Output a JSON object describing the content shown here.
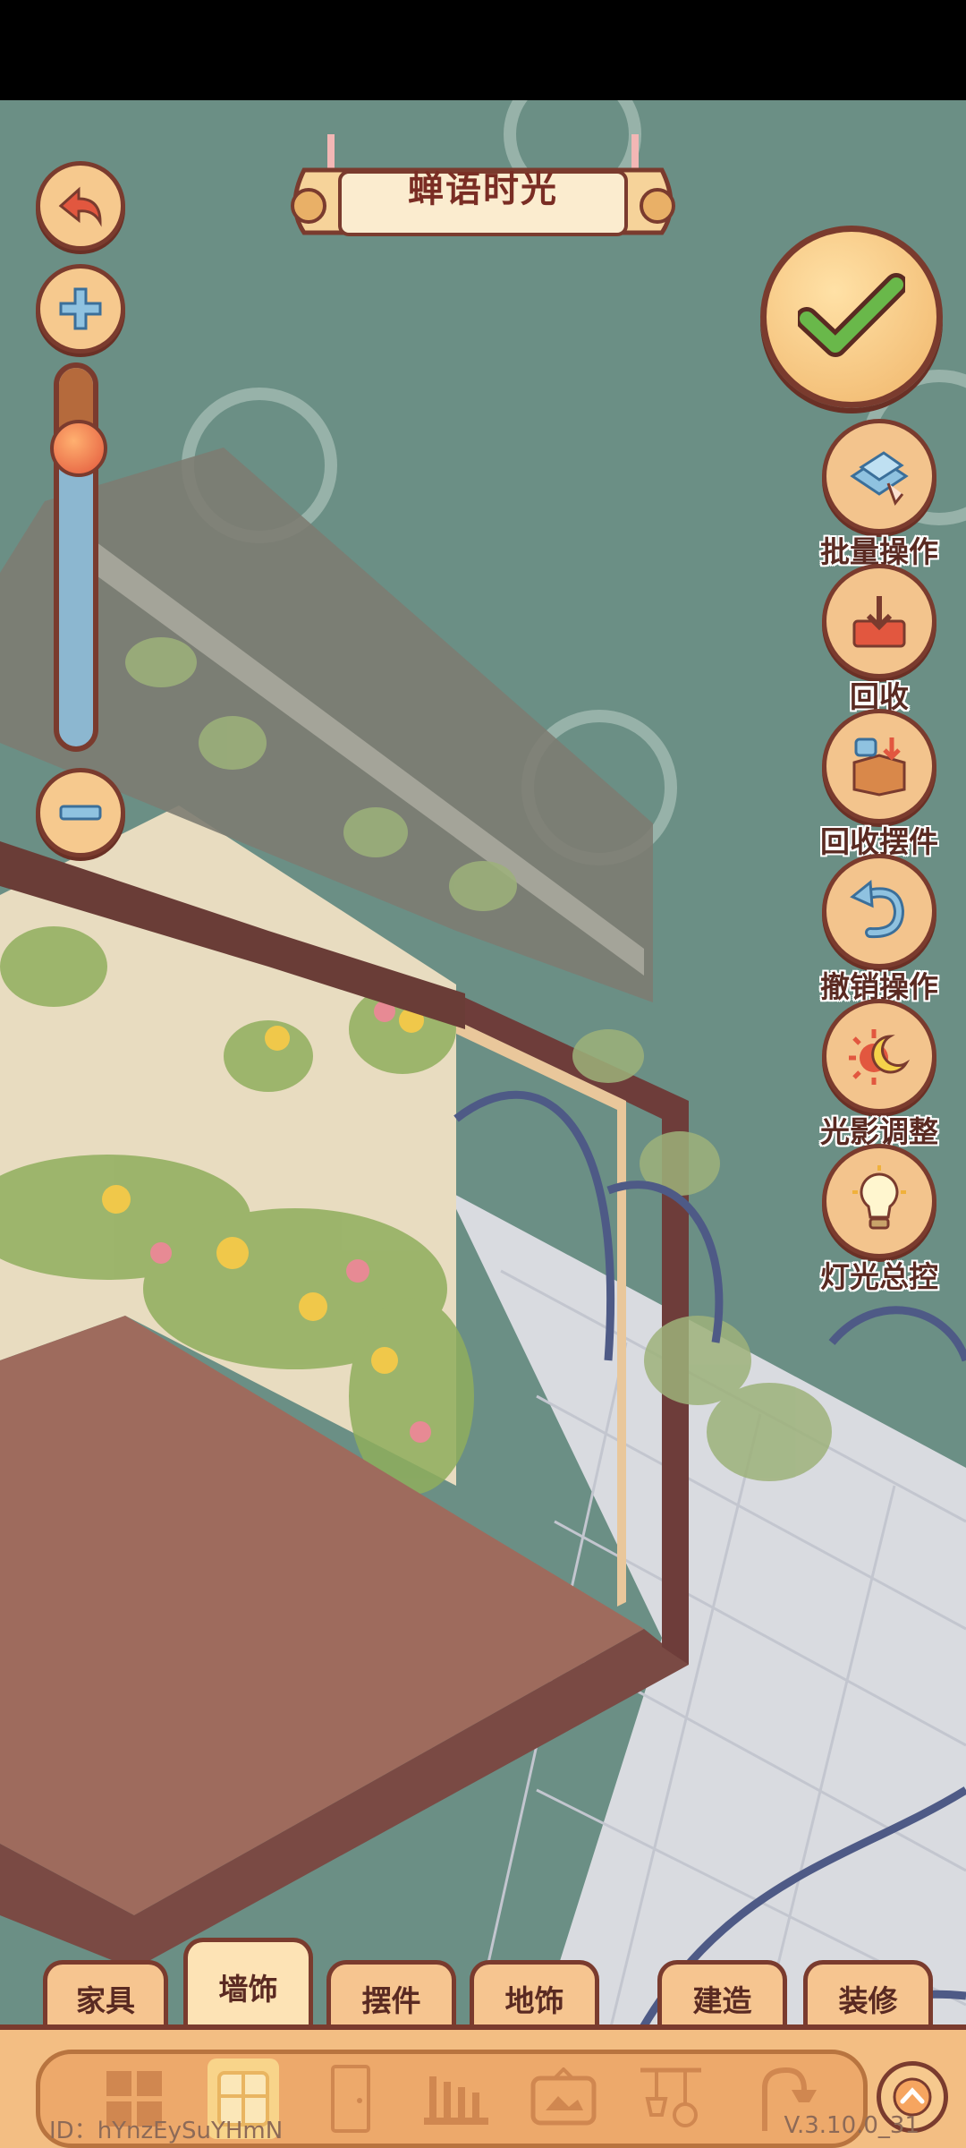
{
  "header": {
    "title": "蝉语时光"
  },
  "zoom": {
    "level": 0.83
  },
  "tools": [
    {
      "label": "批量操作",
      "icon": "batch-select-icon"
    },
    {
      "label": "回收",
      "icon": "recycle-tray-icon"
    },
    {
      "label": "回收摆件",
      "icon": "recycle-box-icon"
    },
    {
      "label": "撤销操作",
      "icon": "undo-arrow-icon"
    },
    {
      "label": "光影调整",
      "icon": "sun-moon-icon"
    },
    {
      "label": "灯光总控",
      "icon": "lightbulb-icon"
    }
  ],
  "tabs": [
    {
      "label": "家具",
      "active": false
    },
    {
      "label": "墙饰",
      "active": true
    },
    {
      "label": "摆件",
      "active": false
    },
    {
      "label": "地饰",
      "active": false
    },
    {
      "label": "建造",
      "active": false
    },
    {
      "label": "装修",
      "active": false
    }
  ],
  "categories": [
    "grid-icon",
    "window-icon",
    "door-icon",
    "fence-icon",
    "frame-icon",
    "hanging-icon",
    "shower-icon"
  ],
  "footer": {
    "id": "ID：hYnzEySuYHmN",
    "version": "V.3.10.0_31"
  },
  "colors": {
    "scene_bg": "#6b8f85",
    "accent": "#7a3b2e",
    "panel": "#f3be83",
    "floor": "#9e6b5d"
  }
}
